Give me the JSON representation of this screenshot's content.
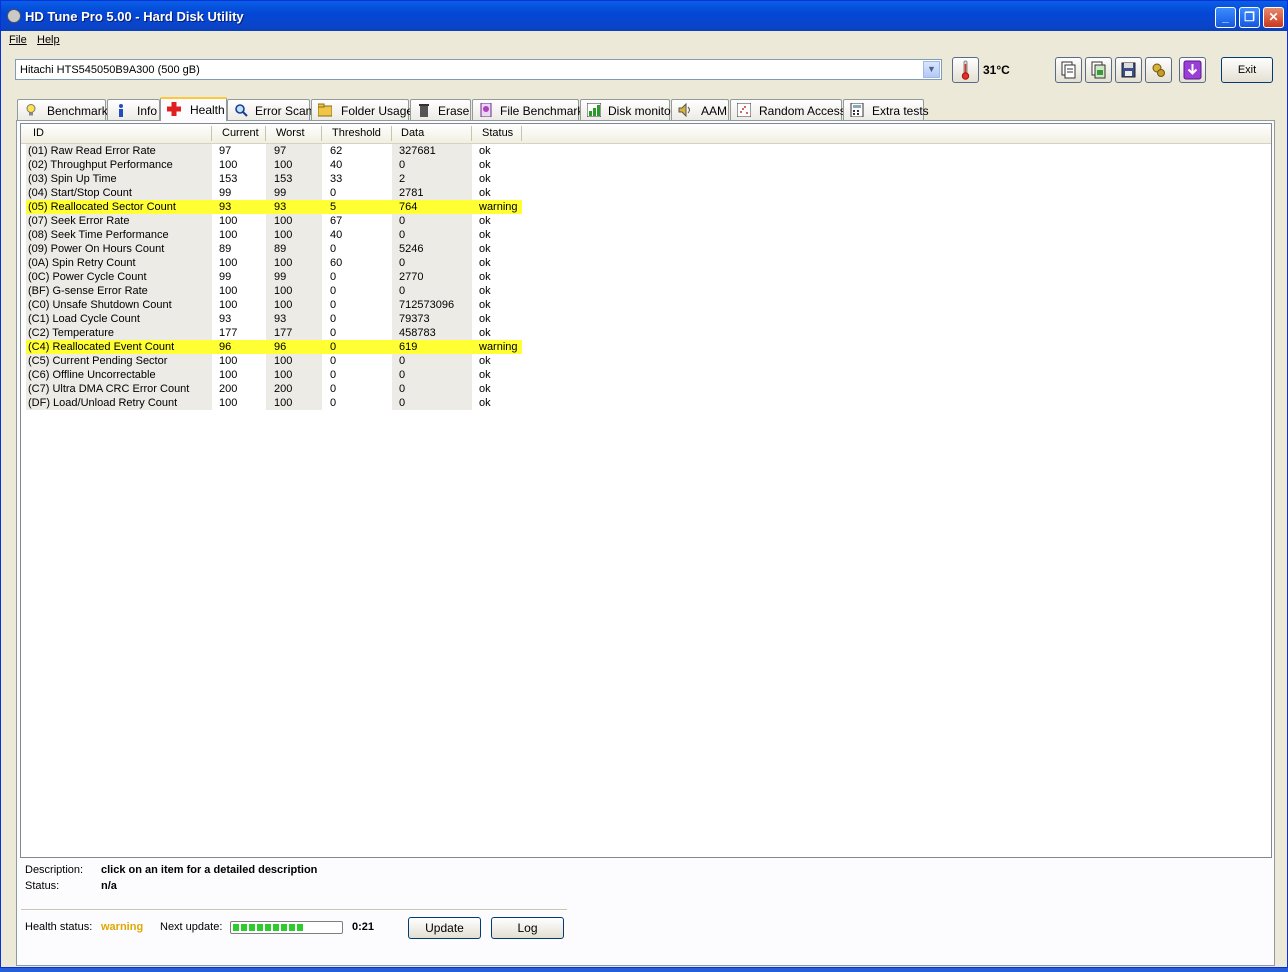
{
  "window": {
    "title": "HD Tune Pro 5.00 - Hard Disk Utility"
  },
  "menu": [
    {
      "label": "File"
    },
    {
      "label": "Help"
    }
  ],
  "toolbar": {
    "drive": "Hitachi HTS545050B9A300 (500 gB)",
    "temperature": "31°C",
    "exit_label": "Exit",
    "icons": [
      "copy-text-icon",
      "copy-screenshot-icon",
      "save-icon",
      "options-icon",
      "download-icon"
    ]
  },
  "tabs": [
    {
      "label": "Benchmark",
      "icon": "lightbulb-icon"
    },
    {
      "label": "Info",
      "icon": "info-icon"
    },
    {
      "label": "Health",
      "icon": "health-cross-icon",
      "active": true
    },
    {
      "label": "Error Scan",
      "icon": "magnifier-icon"
    },
    {
      "label": "Folder Usage",
      "icon": "folder-icon"
    },
    {
      "label": "Erase",
      "icon": "trash-icon"
    },
    {
      "label": "File Benchmark",
      "icon": "file-benchmark-icon"
    },
    {
      "label": "Disk monitor",
      "icon": "monitor-chart-icon"
    },
    {
      "label": "AAM",
      "icon": "speaker-icon"
    },
    {
      "label": "Random Access",
      "icon": "random-access-icon"
    },
    {
      "label": "Extra tests",
      "icon": "calculator-icon"
    }
  ],
  "table": {
    "headers": {
      "id": "ID",
      "current": "Current",
      "worst": "Worst",
      "threshold": "Threshold",
      "data": "Data",
      "status": "Status"
    },
    "rows": [
      {
        "id": "(01) Raw Read Error Rate",
        "current": "97",
        "worst": "97",
        "threshold": "62",
        "data": "327681",
        "status": "ok"
      },
      {
        "id": "(02) Throughput Performance",
        "current": "100",
        "worst": "100",
        "threshold": "40",
        "data": "0",
        "status": "ok"
      },
      {
        "id": "(03) Spin Up Time",
        "current": "153",
        "worst": "153",
        "threshold": "33",
        "data": "2",
        "status": "ok"
      },
      {
        "id": "(04) Start/Stop Count",
        "current": "99",
        "worst": "99",
        "threshold": "0",
        "data": "2781",
        "status": "ok"
      },
      {
        "id": "(05) Reallocated Sector Count",
        "current": "93",
        "worst": "93",
        "threshold": "5",
        "data": "764",
        "status": "warning"
      },
      {
        "id": "(07) Seek Error Rate",
        "current": "100",
        "worst": "100",
        "threshold": "67",
        "data": "0",
        "status": "ok"
      },
      {
        "id": "(08) Seek Time Performance",
        "current": "100",
        "worst": "100",
        "threshold": "40",
        "data": "0",
        "status": "ok"
      },
      {
        "id": "(09) Power On Hours Count",
        "current": "89",
        "worst": "89",
        "threshold": "0",
        "data": "5246",
        "status": "ok"
      },
      {
        "id": "(0A) Spin Retry Count",
        "current": "100",
        "worst": "100",
        "threshold": "60",
        "data": "0",
        "status": "ok"
      },
      {
        "id": "(0C) Power Cycle Count",
        "current": "99",
        "worst": "99",
        "threshold": "0",
        "data": "2770",
        "status": "ok"
      },
      {
        "id": "(BF) G-sense Error Rate",
        "current": "100",
        "worst": "100",
        "threshold": "0",
        "data": "0",
        "status": "ok"
      },
      {
        "id": "(C0) Unsafe Shutdown Count",
        "current": "100",
        "worst": "100",
        "threshold": "0",
        "data": "712573096",
        "status": "ok"
      },
      {
        "id": "(C1) Load Cycle Count",
        "current": "93",
        "worst": "93",
        "threshold": "0",
        "data": "79373",
        "status": "ok"
      },
      {
        "id": "(C2) Temperature",
        "current": "177",
        "worst": "177",
        "threshold": "0",
        "data": "458783",
        "status": "ok"
      },
      {
        "id": "(C4) Reallocated Event Count",
        "current": "96",
        "worst": "96",
        "threshold": "0",
        "data": "619",
        "status": "warning"
      },
      {
        "id": "(C5) Current Pending Sector",
        "current": "100",
        "worst": "100",
        "threshold": "0",
        "data": "0",
        "status": "ok"
      },
      {
        "id": "(C6) Offline Uncorrectable",
        "current": "100",
        "worst": "100",
        "threshold": "0",
        "data": "0",
        "status": "ok"
      },
      {
        "id": "(C7) Ultra DMA CRC Error Count",
        "current": "200",
        "worst": "200",
        "threshold": "0",
        "data": "0",
        "status": "ok"
      },
      {
        "id": "(DF) Load/Unload Retry Count",
        "current": "100",
        "worst": "100",
        "threshold": "0",
        "data": "0",
        "status": "ok"
      }
    ]
  },
  "details": {
    "description_label": "Description:",
    "description_value": "click on an item for a detailed description",
    "status_label": "Status:",
    "status_value": "n/a"
  },
  "footer": {
    "health_label": "Health status:",
    "health_value": "warning",
    "health_color": "#e0a800",
    "warning_row_color": "#ffff33",
    "next_update_label": "Next update:",
    "progress_fraction": 0.66,
    "countdown": "0:21",
    "update_label": "Update",
    "log_label": "Log"
  }
}
